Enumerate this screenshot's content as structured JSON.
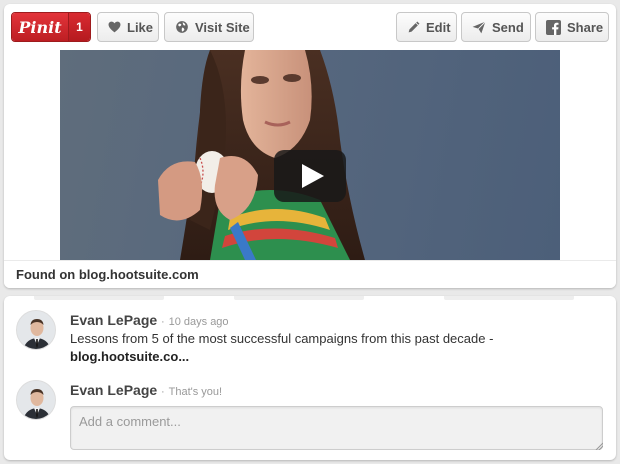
{
  "toolbar": {
    "pin_label": "Pinit",
    "pin_count": "1",
    "like_label": "Like",
    "visit_label": "Visit Site",
    "edit_label": "Edit",
    "send_label": "Send",
    "share_label": "Share"
  },
  "source": {
    "prefix": "Found on",
    "domain": "blog.hootsuite.com"
  },
  "comments": [
    {
      "author": "Evan LePage",
      "separator": "·",
      "meta": "10 days ago",
      "text": "Lessons from 5 of the most successful campaigns from this past decade -",
      "link": "blog.hootsuite.co..."
    },
    {
      "author": "Evan LePage",
      "separator": "·",
      "meta": "That's you!"
    }
  ],
  "comment_input": {
    "placeholder": "Add a comment..."
  },
  "colors": {
    "pin_red": "#cb2027",
    "text": "#333333",
    "muted": "#999999",
    "background": "#e9e9e9"
  },
  "icons": {
    "like": "heart-icon",
    "visit": "globe-icon",
    "edit": "pencil-icon",
    "send": "paper-plane-icon",
    "share": "facebook-icon",
    "play": "play-icon"
  }
}
